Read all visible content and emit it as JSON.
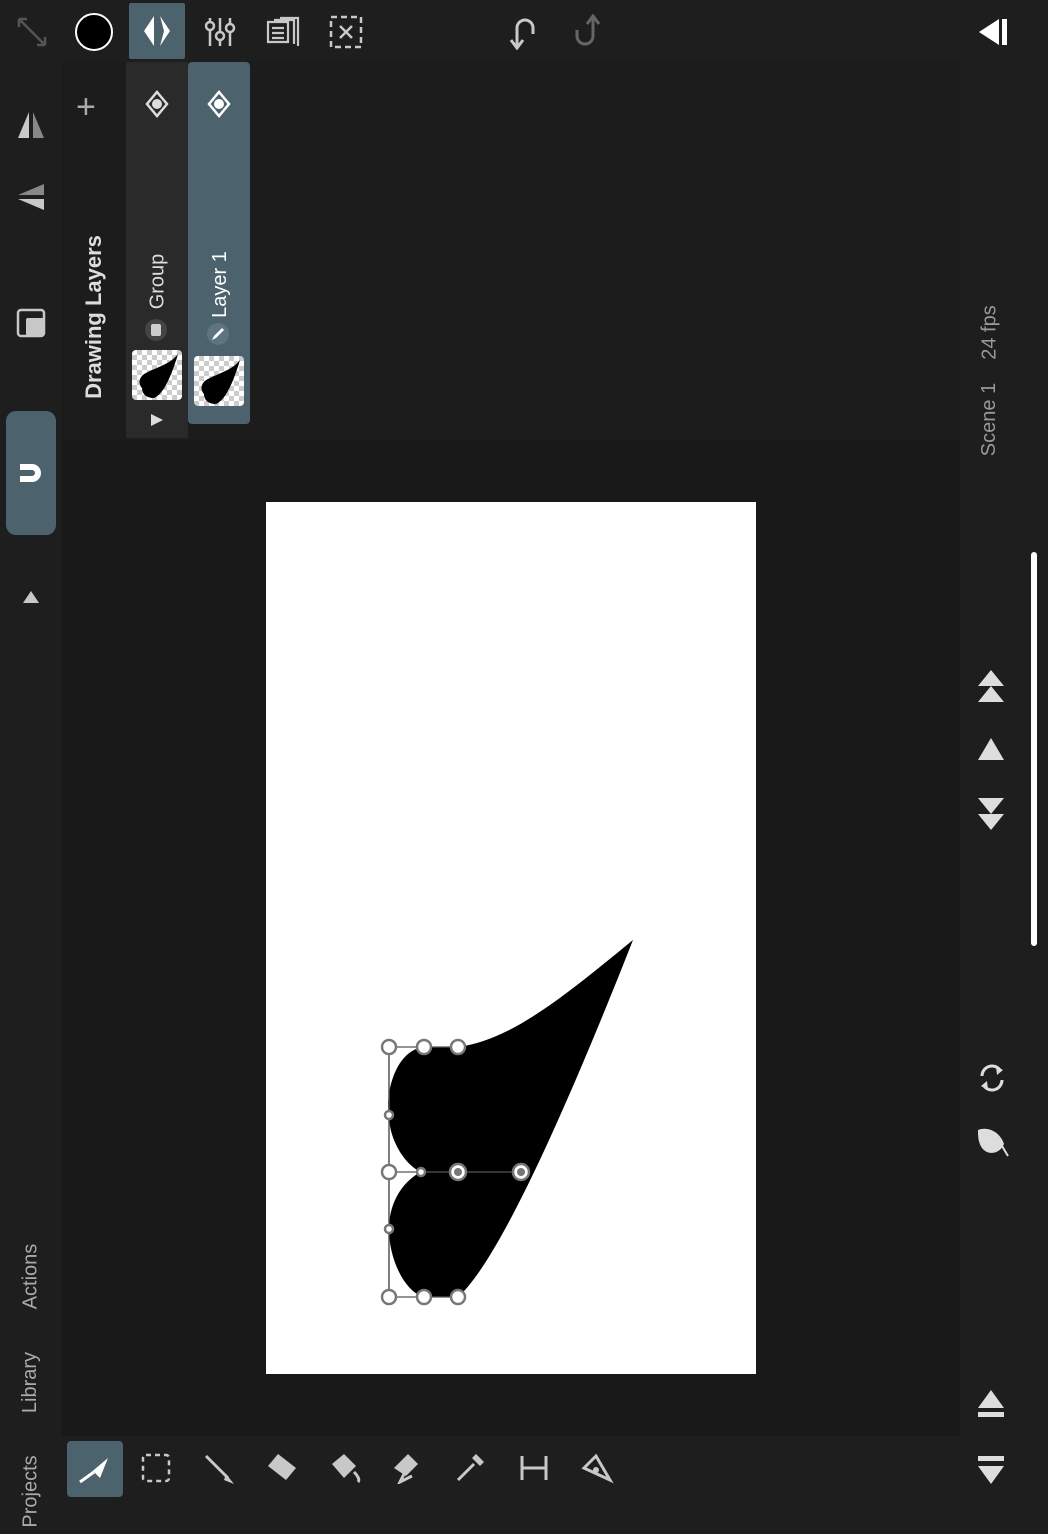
{
  "app": {
    "accent": "#4c626d",
    "background": "#1e1e1e",
    "paper": "#ffffff"
  },
  "toolbar": {
    "icons": [
      "expand-icon",
      "color-swatch",
      "layers-icon",
      "adjust-icon",
      "onion-icon",
      "clear-selection-icon",
      "undo-icon",
      "redo-icon",
      "collapse-panel-icon"
    ],
    "color_swatch": "#000000"
  },
  "layers": {
    "title": "Drawing Layers",
    "add_label": "+",
    "items": [
      {
        "name": "Group",
        "type": "group"
      },
      {
        "name": "Layer 1",
        "type": "layer",
        "selected": true
      }
    ]
  },
  "side": {
    "scene": "Scene 1",
    "fps": "24 fps",
    "bottom_tabs": [
      "Actions",
      "Library",
      "Projects"
    ]
  },
  "bottom_tools": [
    "transform-tool",
    "select-tool",
    "brush-tool",
    "eraser-tool",
    "fill-tool",
    "smudge-tool",
    "eyedropper-tool",
    "ruler-tool",
    "pen-tool"
  ]
}
